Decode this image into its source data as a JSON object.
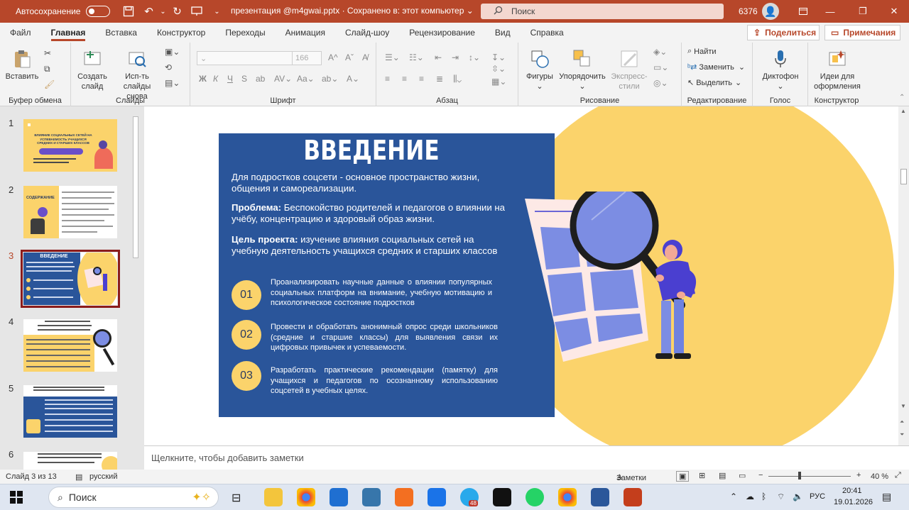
{
  "titlebar": {
    "autosave_label": "Автосохранение",
    "filename": "презентация @m4gwai.pptx  ·  Сохранено в: этот компьютер  ⌄",
    "search_placeholder": "Поиск",
    "user_id": "6376",
    "accent_color": "#b7472a"
  },
  "menu": {
    "tabs": [
      "Файл",
      "Главная",
      "Вставка",
      "Конструктор",
      "Переходы",
      "Анимация",
      "Слайд-шоу",
      "Рецензирование",
      "Вид",
      "Справка"
    ],
    "active_tab": "Главная",
    "share_label": "Поделиться",
    "comments_label": "Примечания"
  },
  "ribbon": {
    "clipboard": {
      "paste_label": "Вставить",
      "group_label": "Буфер обмена"
    },
    "slides": {
      "new_slide_label": "Создать слайд",
      "reuse_label": "Исп-ть слайды снова",
      "group_label": "Слайды"
    },
    "font": {
      "font_size": "166",
      "group_label": "Шрифт",
      "bold": "Ж",
      "italic": "К",
      "underline": "Ч",
      "strike": "S",
      "size_up": "A^",
      "size_down": "Aˇ"
    },
    "paragraph": {
      "group_label": "Абзац"
    },
    "drawing": {
      "shapes_label": "Фигуры",
      "arrange_label": "Упорядочить",
      "styles_label": "Экспресс-стили",
      "group_label": "Рисование"
    },
    "editing": {
      "find_label": "Найти",
      "replace_label": "Заменить",
      "select_label": "Выделить",
      "group_label": "Редактирование"
    },
    "voice": {
      "dictate_label": "Диктофон",
      "group_label": "Голос"
    },
    "designer": {
      "ideas_label": "Идеи для оформления",
      "group_label": "Конструктор"
    }
  },
  "thumbnails": {
    "numbers": [
      "1",
      "2",
      "3",
      "4",
      "5",
      "6"
    ],
    "active_index": 2,
    "thumb1_title": "ВЛИЯНИЕ СОЦИАЛЬНЫХ СЕТЕЙ НА УСПЕВАЕМОСТЬ УЧАЩИХСЯ СРЕДНИХ И СТАРШИХ КЛАССОВ",
    "thumb2_title": "СОДЕРЖАНИЕ",
    "thumb3_title": "ВВЕДЕНИЕ"
  },
  "slide": {
    "title": "ВВЕДЕНИЕ",
    "intro": "Для подростков соцсети - основное пространство жизни, общения и самореализации.",
    "problem_label": "Проблема:",
    "problem_text": " Беспокойство родителей и педагогов о влиянии на учёбу, концентрацию и здоровый образ жизни.",
    "goal_label": "Цель проекта:",
    "goal_text": " изучение влияния социальных сетей на учебную деятельность учащихся средних и старших классов",
    "items": [
      {
        "num": "01",
        "text": "Проанализировать научные данные о влиянии популярных социальных платформ на внимание, учебную мотивацию и психологическое состояние подростков"
      },
      {
        "num": "02",
        "text": "Провести и обработать анонимный опрос среди школьников (средние и старшие классы) для выявления связи их цифровых привычек и успеваемости."
      },
      {
        "num": "03",
        "text": "Разработать практические рекомендации (памятку) для учащихся и педагогов по осознанному использованию соцсетей в учебных целях."
      }
    ],
    "blue_color": "#2a559a",
    "yellow_color": "#fbd36b"
  },
  "notes": {
    "placeholder": "Щелкните, чтобы добавить заметки"
  },
  "status": {
    "slide_counter": "Слайд 3 из 13",
    "language": "русский",
    "notes_label": "Заметки",
    "zoom": "40 %"
  },
  "taskbar": {
    "search_label": "Поиск",
    "lang": "РУС",
    "time": "20:41",
    "date": "19.01.2026",
    "telegram_badge": "48"
  }
}
